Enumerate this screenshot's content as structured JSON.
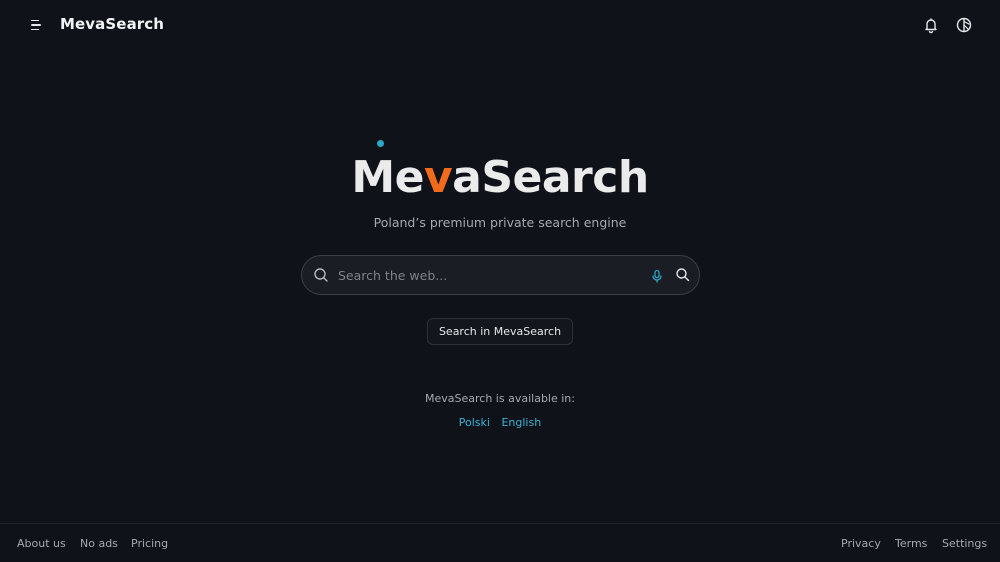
{
  "header": {
    "brand": "MevaSearch",
    "icons": [
      "menu-icon",
      "bell-icon",
      "theme-toggle-icon"
    ]
  },
  "hero": {
    "logo_prefix": "Me",
    "logo_accent": "v",
    "logo_suffix": "aSearch",
    "tagline": "Poland’s premium private search engine"
  },
  "search": {
    "placeholder": "Search the web...",
    "value": "",
    "button_label": "Search in MevaSearch"
  },
  "availability": {
    "label": "MevaSearch is available in:",
    "languages": [
      "Polski",
      "English"
    ]
  },
  "footer": {
    "left_links": [
      "About us",
      "No ads",
      "Pricing"
    ],
    "right_links": [
      "Privacy",
      "Terms",
      "Settings"
    ]
  },
  "colors": {
    "background": "#0f1218",
    "accent_orange": "#f26b1d",
    "accent_cyan": "#2aa9c7",
    "link": "#3bb4d6"
  }
}
